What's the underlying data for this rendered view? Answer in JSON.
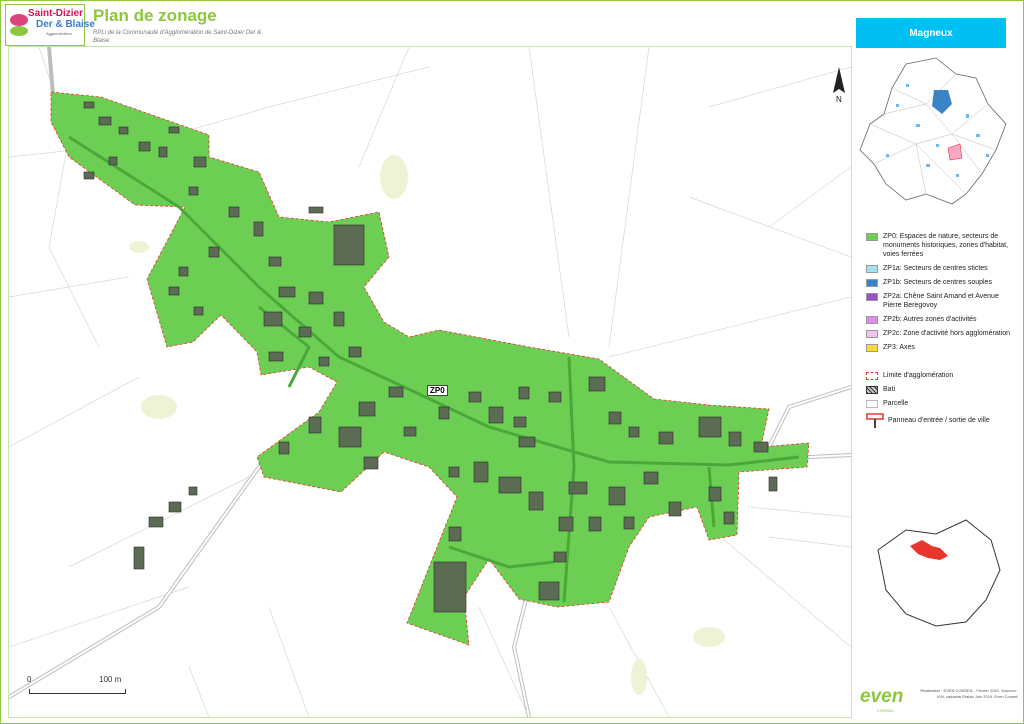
{
  "header": {
    "logo_line1": "Saint-Dizier",
    "logo_line2": "Der & Blaise",
    "logo_line3": "Agglomération",
    "title": "Plan de zonage",
    "subtitle": "RPLi de la Communauté d'Agglomération de Saint-Dizier Der & Blaise"
  },
  "map": {
    "zone_label": "ZP0",
    "north_label": "N",
    "scale_start": "0",
    "scale_end": "100 m",
    "zone_color": "#6ccf54",
    "boundary_color": "#e8352d"
  },
  "panel": {
    "commune": "Magneux",
    "legend": [
      {
        "label": "ZP0: Espaces de nature, secteurs de monuments historiques, zones d'habitat, voies ferrées",
        "color": "#6ccf54"
      },
      {
        "label": "ZP1a: Secteurs de centres stictes",
        "color": "#a6e3f0"
      },
      {
        "label": "ZP1b: Secteurs de centres souples",
        "color": "#3b83c6"
      },
      {
        "label": "ZP2a: Chêne Saint Amand et Avenue Pierre Beregovoy",
        "color": "#9b4fc9"
      },
      {
        "label": "ZP2b: Autres zones d'activités",
        "color": "#e28ae8"
      },
      {
        "label": "ZP2c: Zone d'activité hors agglomération",
        "color": "#f7c2ee"
      },
      {
        "label": "ZP3: Axes",
        "color": "#ffd83a"
      }
    ],
    "legend2": [
      {
        "label": "Limite d'agglomération"
      },
      {
        "label": "Bati"
      },
      {
        "label": "Parcelle"
      },
      {
        "label": "Panneau d'entrée / sortie de ville"
      }
    ]
  },
  "credits": {
    "logo": "even",
    "logo_sub": "CONSEIL",
    "text": "Réalisation : EVEN CONSEIL - Février 2020. Sources : IGN, cadastre Etalab Juin 2019, Even Conseil"
  }
}
